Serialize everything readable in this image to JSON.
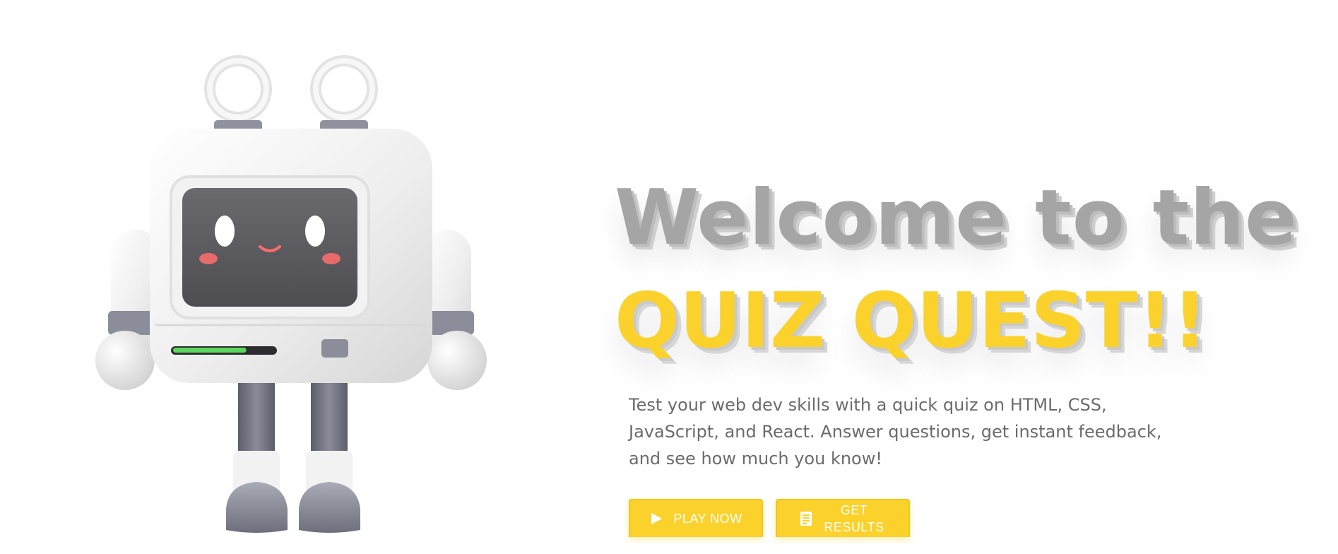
{
  "hero": {
    "headline_line1": "Welcome to the",
    "headline_line2": "QUIZ QUEST!!",
    "description": "Test your web dev skills with a quick quiz on HTML, CSS, JavaScript, and React. Answer questions, get instant feedback, and see how much you know!"
  },
  "actions": {
    "play_label": "PLAY NOW",
    "play_icon": "play-icon",
    "results_label": "GET RESULTS",
    "results_icon": "document-icon"
  },
  "colors": {
    "accent": "#fbd22b",
    "headline_gray": "#a5a5a5",
    "body_text": "#6b6b6b",
    "progress_green": "#5cd65c"
  },
  "illustration": {
    "name": "robot-mascot",
    "progress_fraction": 0.72
  }
}
